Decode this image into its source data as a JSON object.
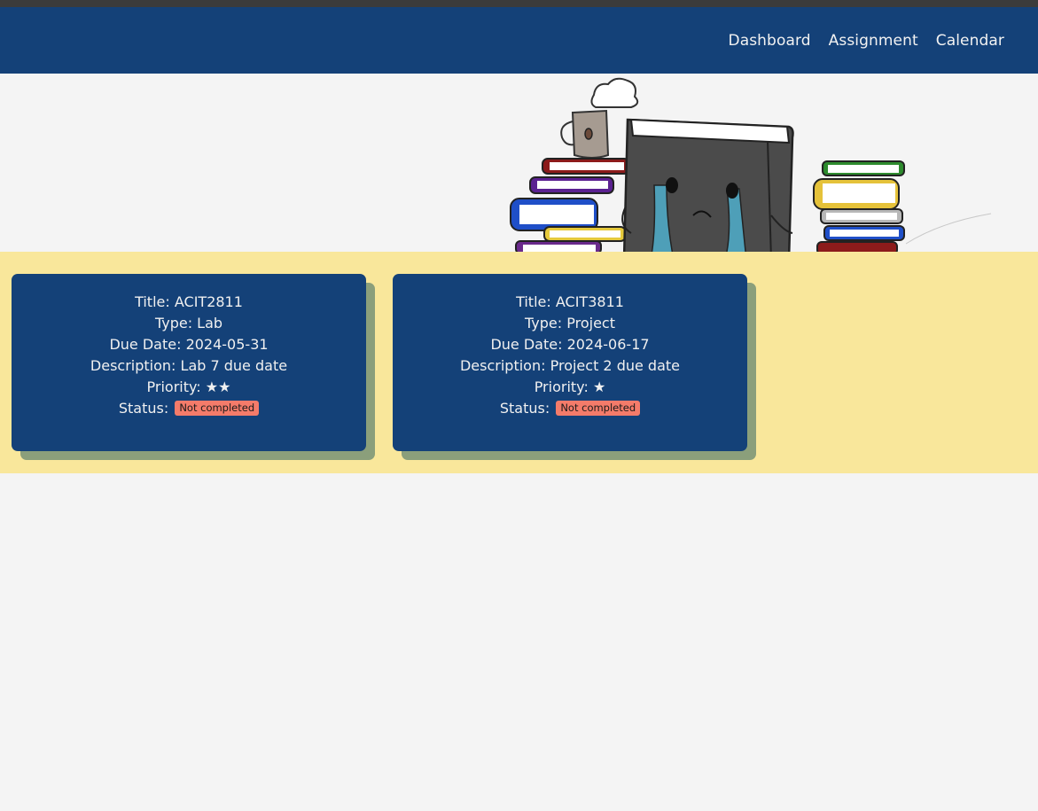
{
  "nav": {
    "items": [
      {
        "label": "Dashboard"
      },
      {
        "label": "Assignment"
      },
      {
        "label": "Calendar"
      }
    ]
  },
  "banner": {
    "image": "crying-book-illustration"
  },
  "assignments": [
    {
      "title_label": "Title:",
      "title": "ACIT2811",
      "type_label": "Type:",
      "type": "Lab",
      "due_label": "Due Date:",
      "due": "2024-05-31",
      "desc_label": "Description:",
      "desc": "Lab 7 due date",
      "priority_label": "Priority:",
      "priority": "★★",
      "status_label": "Status:",
      "status": "Not completed"
    },
    {
      "title_label": "Title:",
      "title": "ACIT3811",
      "type_label": "Type:",
      "type": "Project",
      "due_label": "Due Date:",
      "due": "2024-06-17",
      "desc_label": "Description:",
      "desc": "Project 2 due date",
      "priority_label": "Priority:",
      "priority": "★",
      "status_label": "Status:",
      "status": "Not completed"
    }
  ],
  "colors": {
    "navbar": "#144178",
    "card": "#144178",
    "section_bg": "#f9e79b",
    "card_shadow": "#8b9f7b",
    "badge": "#f47b6a"
  }
}
